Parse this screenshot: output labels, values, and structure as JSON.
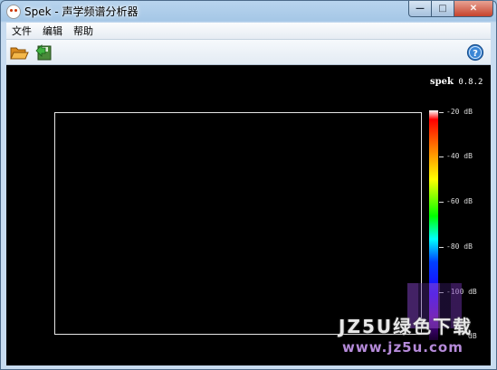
{
  "window": {
    "title": "Spek - 声学频谱分析器",
    "buttons": {
      "minimize": "—",
      "maximize": "□",
      "close": "✕"
    }
  },
  "menu": {
    "items": [
      "文件",
      "编辑",
      "帮助"
    ]
  },
  "toolbar": {
    "icons": [
      "folder-open-icon",
      "save-icon",
      "help-icon"
    ]
  },
  "spectrum": {
    "brand_name": "spek",
    "version": "0.8.2",
    "scale_labels": [
      "-20 dB",
      "-40 dB",
      "-60 dB",
      "-80 dB",
      "-100 dB",
      "dB"
    ]
  },
  "watermark": {
    "main": "JZ5U绿色下载",
    "url": "www.jz5u.com"
  }
}
